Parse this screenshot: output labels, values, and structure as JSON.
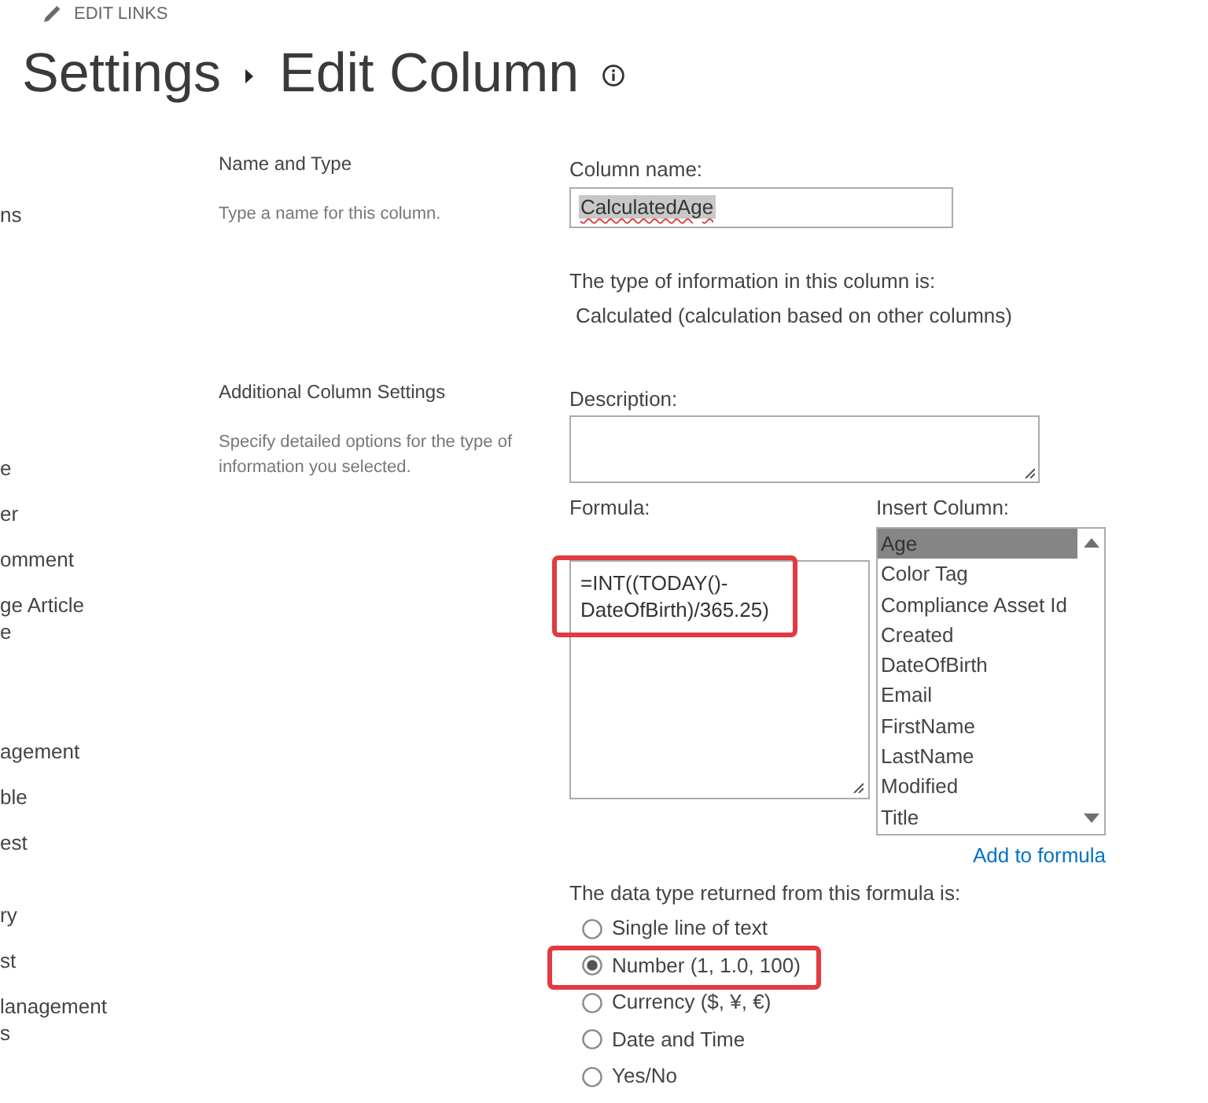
{
  "top_link": {
    "label": "EDIT LINKS"
  },
  "title": {
    "parent": "Settings",
    "current": "Edit Column"
  },
  "nav": {
    "items": [
      {
        "lines": [
          "ns"
        ]
      },
      {
        "lines": [
          "e"
        ]
      },
      {
        "lines": [
          "er"
        ]
      },
      {
        "lines": [
          "omment"
        ]
      },
      {
        "lines": [
          "ge Article",
          "e"
        ]
      },
      {
        "lines": [
          "agement"
        ]
      },
      {
        "lines": [
          "ble"
        ]
      },
      {
        "lines": [
          "est"
        ]
      },
      {
        "lines": [
          "ry"
        ]
      },
      {
        "lines": [
          "st"
        ]
      },
      {
        "lines": [
          "lanagement",
          "s"
        ]
      }
    ]
  },
  "name_section": {
    "title": "Name and Type",
    "description": "Type a name for this column.",
    "column_name": {
      "label": "Column name:",
      "value": "CalculatedAge",
      "text_selected": true,
      "misspelled": true
    },
    "type_label": "The type of information in this column is:",
    "type_value": "Calculated (calculation based on other columns)"
  },
  "settings_section": {
    "title": "Additional Column Settings",
    "description": "Specify detailed options for the type of information you selected.",
    "description_field": {
      "label": "Description:"
    },
    "formula": {
      "label": "Formula:",
      "value": "=INT((TODAY()-DateOfBirth)/365.25)",
      "annotated": true
    },
    "insert_column": {
      "label": "Insert Column:",
      "items": [
        {
          "label": "Age",
          "selected": true
        },
        {
          "label": "Color Tag",
          "selected": false
        },
        {
          "label": "Compliance Asset Id",
          "selected": false
        },
        {
          "label": "Created",
          "selected": false
        },
        {
          "label": "DateOfBirth",
          "selected": false
        },
        {
          "label": "Email",
          "selected": false
        },
        {
          "label": "FirstName",
          "selected": false
        },
        {
          "label": "LastName",
          "selected": false
        },
        {
          "label": "Modified",
          "selected": false
        },
        {
          "label": "Title",
          "selected": false
        }
      ],
      "action": "Add to formula"
    },
    "return_type": {
      "label": "The data type returned from this formula is:",
      "options": [
        {
          "label": "Single line of text",
          "selected": false,
          "annotated": false
        },
        {
          "label": "Number (1, 1.0, 100)",
          "selected": true,
          "annotated": true
        },
        {
          "label": "Currency ($, ¥, €)",
          "selected": false,
          "annotated": false
        },
        {
          "label": "Date and Time",
          "selected": false,
          "annotated": false
        },
        {
          "label": "Yes/No",
          "selected": false,
          "annotated": false
        }
      ]
    }
  }
}
